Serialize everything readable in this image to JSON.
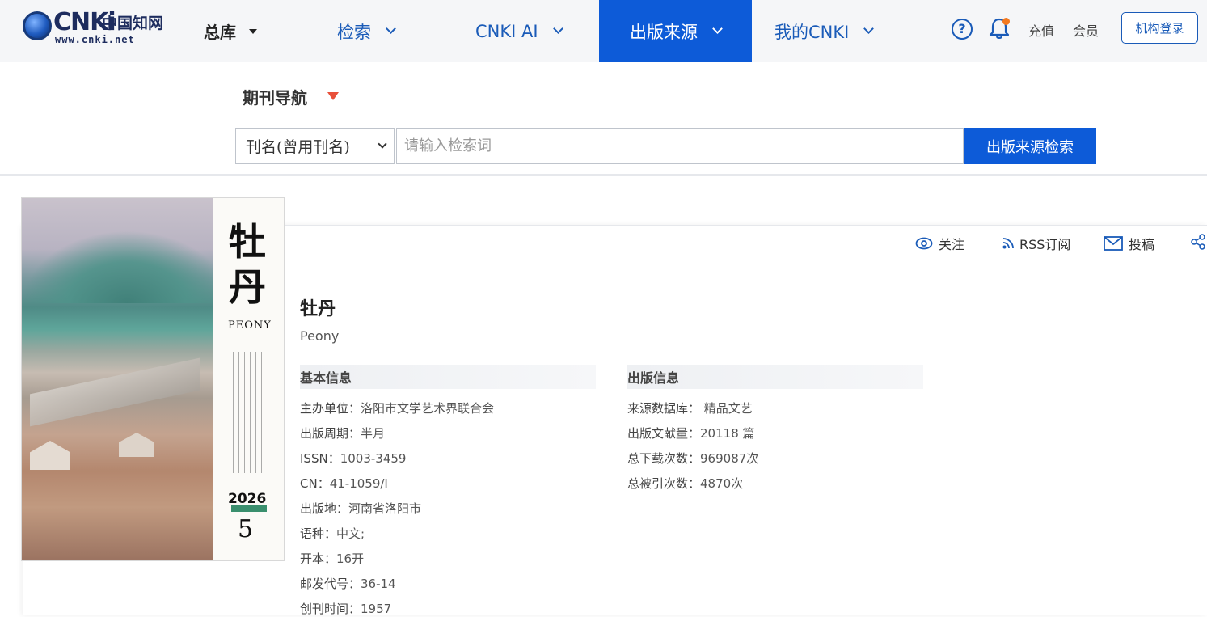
{
  "logo": {
    "word": "CNKi",
    "cn": "中国知网",
    "url": "www.cnki.net"
  },
  "nav": {
    "zongku": "总库",
    "jiansuo": "检索",
    "cnkiai": "CNKI AI",
    "chuban": "出版来源",
    "mine": "我的CNKI"
  },
  "top_links": {
    "help": "?",
    "chongzhi": "充值",
    "huiyuan": "会员",
    "login": "机构登录"
  },
  "search": {
    "journal_nav": "期刊导航",
    "field": "刊名(曾用刊名)",
    "placeholder": "请输入检索词",
    "button": "出版来源检索"
  },
  "cover": {
    "title_line1": "牡",
    "title_line2": "丹",
    "en": "PEONY",
    "year": "2026",
    "issue": "5"
  },
  "actions": {
    "follow": "关注",
    "rss": "RSS订阅",
    "submit": "投稿"
  },
  "journal": {
    "title": "牡丹",
    "en": "Peony",
    "basic_head": "基本信息",
    "pub_head": "出版信息",
    "basic": [
      {
        "k": "主办单位：",
        "v": "洛阳市文学艺术界联合会"
      },
      {
        "k": "出版周期：",
        "v": "半月"
      },
      {
        "k": "ISSN：",
        "v": "1003-3459"
      },
      {
        "k": "CN：",
        "v": "41-1059/I"
      },
      {
        "k": "出版地：",
        "v": "河南省洛阳市"
      },
      {
        "k": "语种：",
        "v": "中文;"
      },
      {
        "k": "开本：",
        "v": "16开"
      },
      {
        "k": "邮发代号：",
        "v": "36-14"
      },
      {
        "k": "创刊时间：",
        "v": "1957"
      }
    ],
    "pub": [
      {
        "k": "来源数据库：",
        "v": " 精品文艺"
      },
      {
        "k": "出版文献量：",
        "v": "20118 篇"
      },
      {
        "k": "总下载次数：",
        "v": "969087次"
      },
      {
        "k": "总被引次数：",
        "v": "4870次"
      }
    ]
  },
  "colors": {
    "brand_blue": "#0d5bd8",
    "link_blue": "#1a5bb8",
    "accent_red": "#e8503a",
    "notify_orange": "#f47a20"
  }
}
